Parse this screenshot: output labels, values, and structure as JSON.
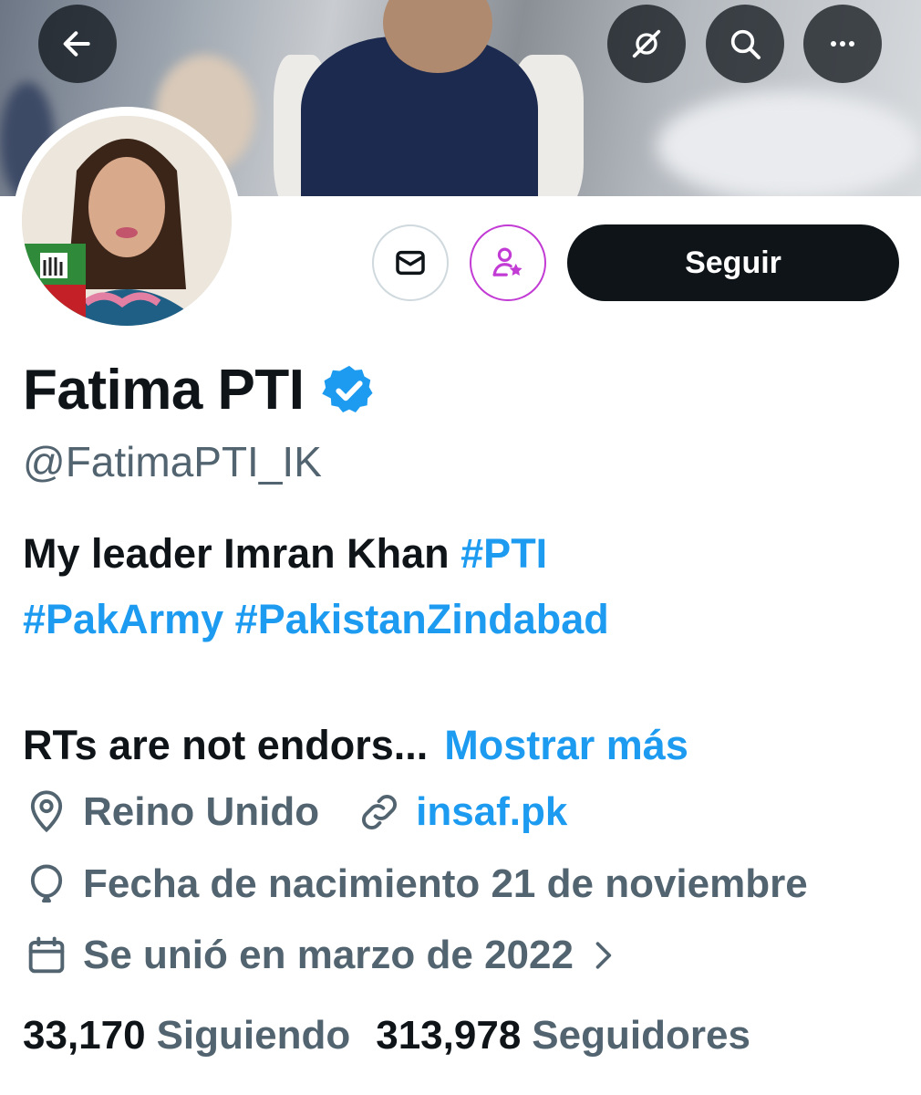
{
  "header": {
    "back_icon": "arrow-left-icon",
    "grok_icon": "grok-icon",
    "search_icon": "search-icon",
    "more_icon": "more-horizontal-icon"
  },
  "actions": {
    "message_icon": "mail-icon",
    "subscribe_icon": "user-star-icon",
    "follow_label": "Seguir"
  },
  "profile": {
    "name": "Fatima PTI",
    "verified_icon": "verified-badge-icon",
    "handle": "@FatimaPTI_IK",
    "bio": {
      "text": "My leader Imran Khan ",
      "hashtag1": "#PTI",
      "hashtag2": "#PakArmy",
      "hashtag3": "#PakistanZindabad",
      "line2": "RTs are not endors...",
      "show_more": "Mostrar más"
    },
    "location": "Reino Unido",
    "website": "insaf.pk",
    "birthday": "Fecha de nacimiento 21 de noviembre",
    "joined": "Se unió en marzo de 2022"
  },
  "stats": {
    "following_count": "33,170",
    "following_label": "Siguiendo",
    "followers_count": "313,978",
    "followers_label": "Seguidores"
  },
  "colors": {
    "accent": "#1d9bf0",
    "text": "#0f1419",
    "muted": "#536471",
    "subscribe": "#c23bd4"
  }
}
